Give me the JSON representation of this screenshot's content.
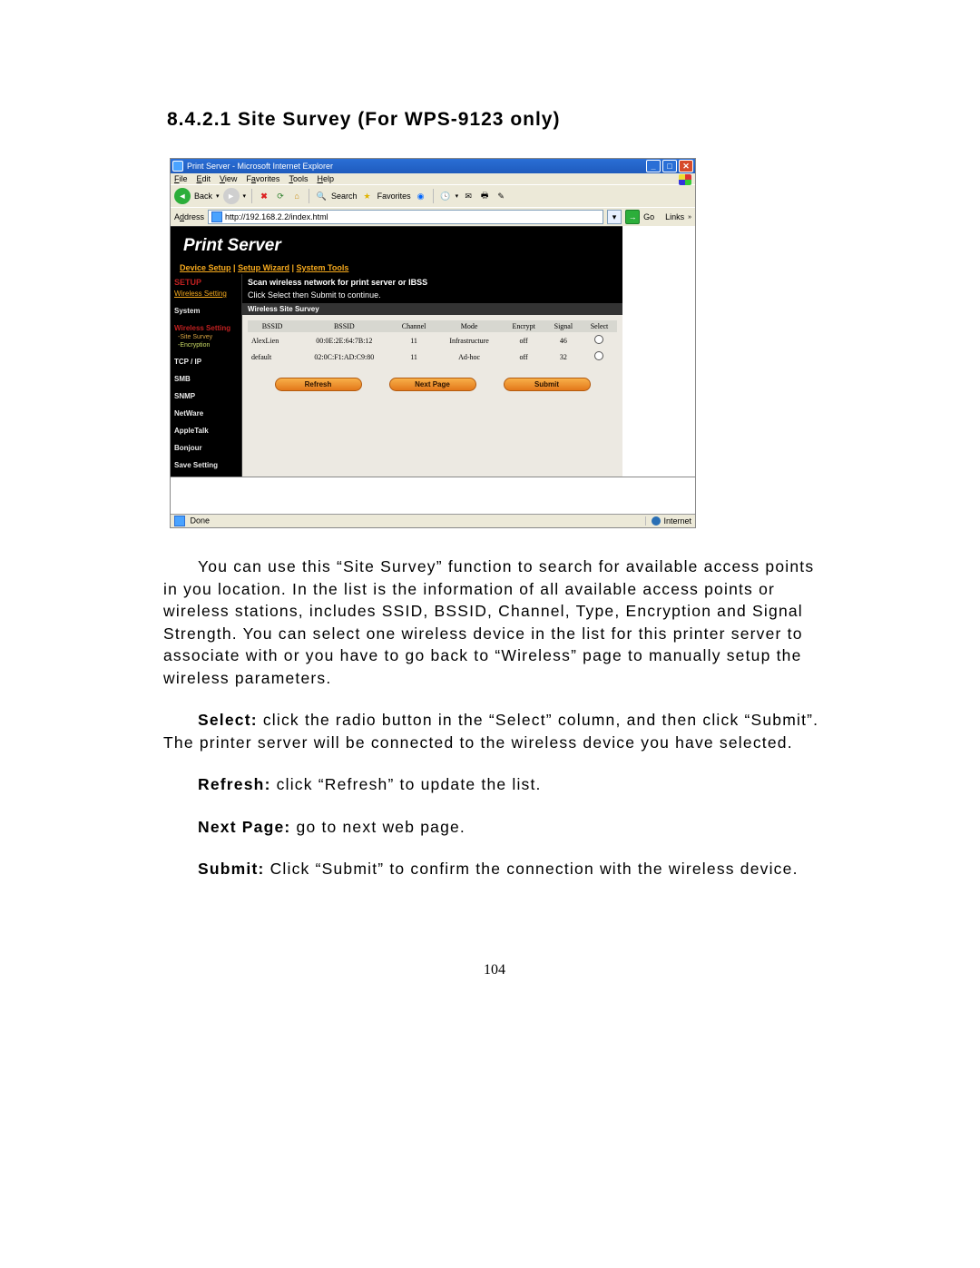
{
  "heading": "8.4.2.1   Site Survey (For WPS-9123 only)",
  "browser": {
    "window_title": "Print Server - Microsoft Internet Explorer",
    "menus": {
      "file": "File",
      "edit": "Edit",
      "view": "View",
      "favorites": "Favorites",
      "tools": "Tools",
      "help": "Help"
    },
    "toolbar": {
      "back": "Back",
      "search": "Search",
      "favorites": "Favorites"
    },
    "address_label": "Address",
    "address_url": "http://192.168.2.2/index.html",
    "go": "Go",
    "links": "Links",
    "status_done": "Done",
    "zone": "Internet"
  },
  "app": {
    "title": "Print Server",
    "topnav": {
      "device_setup": "Device Setup",
      "setup_wizard": "Setup Wizard",
      "system_tools": "System Tools"
    },
    "sidebar": {
      "setup": "SETUP",
      "wireless_setting_link": "Wireless Setting",
      "system": "System",
      "wireless_setting": "Wireless Setting",
      "site_survey": "-Site Survey",
      "encryption": "-Encryption",
      "tcpip": "TCP / IP",
      "smb": "SMB",
      "snmp": "SNMP",
      "netware": "NetWare",
      "appletalk": "AppleTalk",
      "bonjour": "Bonjour",
      "save_setting": "Save Setting"
    },
    "panel": {
      "instr1": "Scan wireless network for print server or IBSS",
      "instr2": "Click Select then Submit to continue.",
      "title": "Wireless Site Survey",
      "headers": {
        "ssid": "BSSID",
        "bssid": "BSSID",
        "channel": "Channel",
        "mode": "Mode",
        "encrypt": "Encrypt",
        "signal": "Signal",
        "select": "Select"
      },
      "rows": [
        {
          "ssid": "AlexLien",
          "bssid": "00:0E:2E:64:7B:12",
          "channel": "11",
          "mode": "Infrastructure",
          "encrypt": "off",
          "signal": "46"
        },
        {
          "ssid": "default",
          "bssid": "02:0C:F1:AD:C9:80",
          "channel": "11",
          "mode": "Ad-hoc",
          "encrypt": "off",
          "signal": "32"
        }
      ],
      "buttons": {
        "refresh": "Refresh",
        "next_page": "Next Page",
        "submit": "Submit"
      }
    }
  },
  "body": {
    "p1": "You can use this “Site Survey” function to search for available access points in you location. In the list is the information of all available access points or wireless stations, includes SSID, BSSID, Channel, Type, Encryption and Signal Strength. You can select one wireless device in the list for this printer server to associate with or you have to go back to “Wireless” page to manually setup the wireless parameters.",
    "select_label": "Select:",
    "select_text": " click the radio button in the “Select” column, and then click “Submit”. The printer server will be connected to the wireless device you have selected.",
    "refresh_label": "Refresh:",
    "refresh_text": " click “Refresh” to update the list.",
    "next_label": "Next Page:",
    "next_text": " go to next web page.",
    "submit_label": "Submit:",
    "submit_text": " Click “Submit” to confirm the connection with the wireless device."
  },
  "page_number": "104"
}
